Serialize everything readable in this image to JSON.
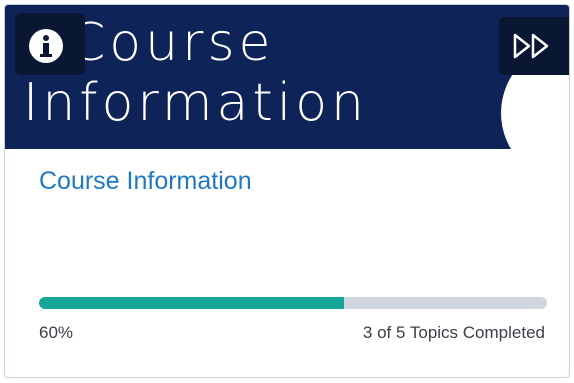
{
  "card": {
    "banner_title": "Course Information",
    "link_label": "Course Information",
    "progress": {
      "percent_label": "60%",
      "fraction": 0.6,
      "status_text": "3 of 5 Topics Completed"
    },
    "icons": {
      "info": "info-icon",
      "expand": "double-chevron-right-icon"
    },
    "colors": {
      "banner": "#0e2358",
      "link": "#1f79c2",
      "progress_fill": "#16a596",
      "progress_track": "#cfd6df"
    }
  }
}
